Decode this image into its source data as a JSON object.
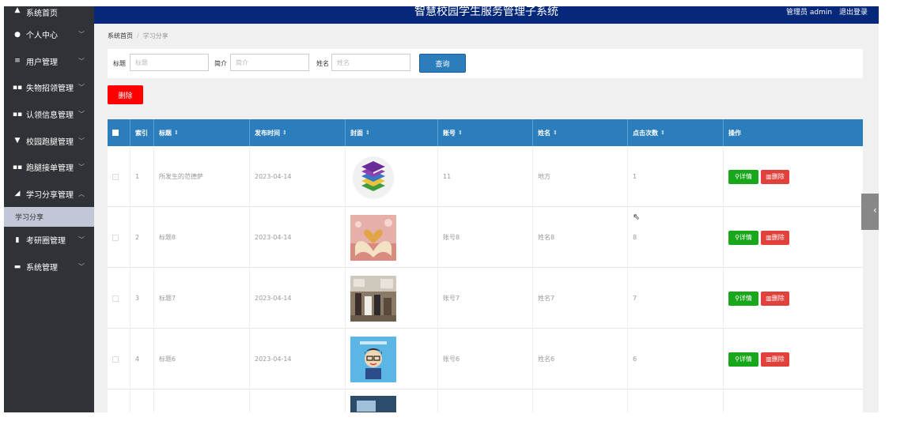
{
  "sidebar": {
    "items": [
      {
        "label": "系统首页",
        "icon": "home-icon",
        "glyph": "▲"
      },
      {
        "label": "个人中心",
        "icon": "user-icon",
        "glyph": "●"
      },
      {
        "label": "用户管理",
        "icon": "list-icon",
        "glyph": "≡"
      },
      {
        "label": "失物招领管理",
        "icon": "grid-icon",
        "glyph": "▪▪"
      },
      {
        "label": "认领信息管理",
        "icon": "grid-icon",
        "glyph": "▪▪"
      },
      {
        "label": "校园跑腿管理",
        "icon": "tag-icon",
        "glyph": "▼"
      },
      {
        "label": "跑腿接单管理",
        "icon": "grid-icon",
        "glyph": "▪▪"
      },
      {
        "label": "学习分享管理",
        "icon": "thumb-icon",
        "glyph": "◢"
      },
      {
        "label": "考研圈管理",
        "icon": "bar-chart-icon",
        "glyph": "▮"
      },
      {
        "label": "系统管理",
        "icon": "monitor-icon",
        "glyph": "▬"
      }
    ],
    "sub_item": "学习分享"
  },
  "header": {
    "title": "智慧校园学生服务管理子系统",
    "user": "管理员 admin",
    "logout": "退出登录"
  },
  "breadcrumb": {
    "home": "系统首页",
    "current": "学习分享"
  },
  "search": {
    "title_label": "标题",
    "title_placeholder": "标题",
    "intro_label": "简介",
    "intro_placeholder": "简介",
    "name_label": "姓名",
    "name_placeholder": "姓名",
    "query_button": "查询"
  },
  "delete_button": "删除",
  "table": {
    "headers": [
      "索引",
      "标题",
      "发布时间",
      "封面",
      "账号",
      "姓名",
      "点击次数",
      "操作"
    ],
    "sort_glyph": "⇕",
    "detail_label": "详情",
    "delete_label": "删除",
    "rows": [
      {
        "index": "1",
        "title": "所发生的范德萨",
        "date": "2023-04-14",
        "account": "11",
        "name": "地方",
        "clicks": "1",
        "cover": "books"
      },
      {
        "index": "2",
        "title": "标题8",
        "date": "2023-04-14",
        "account": "账号8",
        "name": "姓名8",
        "clicks": "8",
        "cover": "open-book"
      },
      {
        "index": "3",
        "title": "标题7",
        "date": "2023-04-14",
        "account": "账号7",
        "name": "姓名7",
        "clicks": "7",
        "cover": "classroom"
      },
      {
        "index": "4",
        "title": "标题6",
        "date": "2023-04-14",
        "account": "账号6",
        "name": "姓名6",
        "clicks": "6",
        "cover": "cartoon"
      }
    ]
  },
  "colors": {
    "header": "#05287a",
    "sidebar": "#2f3237",
    "table_head": "#2b7dbc",
    "detail": "#18a61b",
    "delete": "#e0413a",
    "delete_main": "#ff0000"
  }
}
